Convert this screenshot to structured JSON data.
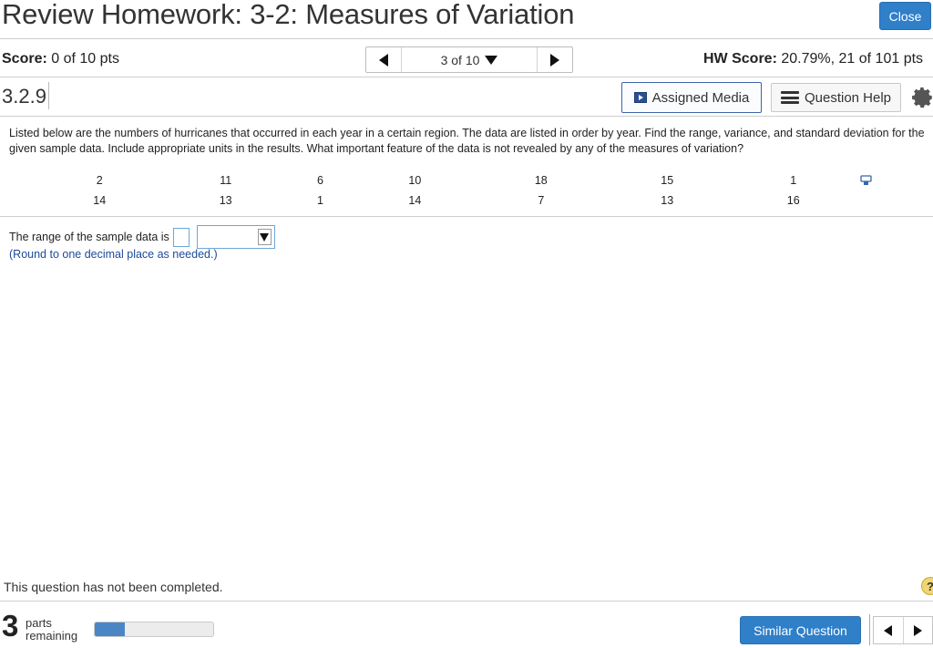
{
  "header": {
    "title": "Review Homework: 3-2: Measures of Variation",
    "close_label": "Close"
  },
  "score_bar": {
    "score_label": "Score:",
    "score_value": "0 of 10 pts",
    "question_position": "3 of 10",
    "hw_score_label": "HW Score:",
    "hw_score_value": "20.79%, 21 of 101 pts"
  },
  "question_bar": {
    "question_number": "3.2.9",
    "assigned_media_label": "Assigned Media",
    "question_help_label": "Question Help"
  },
  "question": {
    "prompt": "Listed below are the numbers of hurricanes that occurred in each year in a certain region. The data are listed in order by year. Find the range, variance, and standard deviation for the given sample data. Include appropriate units in the results. What important feature of the data is not revealed by any of the measures of variation?",
    "data_rows": [
      [
        "2",
        "11",
        "6",
        "10",
        "18",
        "15",
        "1"
      ],
      [
        "14",
        "13",
        "1",
        "14",
        "7",
        "13",
        "16"
      ]
    ],
    "answer_prompt": "The range of the sample data is",
    "answer_value": "",
    "unit_selected": "",
    "round_note": "(Round to one decimal place as needed.)"
  },
  "footer": {
    "status_text": "This question has not been completed.",
    "help_symbol": "?",
    "parts_count": "3",
    "parts_label_1": "parts",
    "parts_label_2": "remaining",
    "progress_fraction": 0.25,
    "similar_label": "Similar Question"
  },
  "colors": {
    "primary_button": "#2f7fc9",
    "progress_fill": "#4a86c5",
    "note_text": "#1c4a9c",
    "input_border": "#6ca7d8"
  }
}
